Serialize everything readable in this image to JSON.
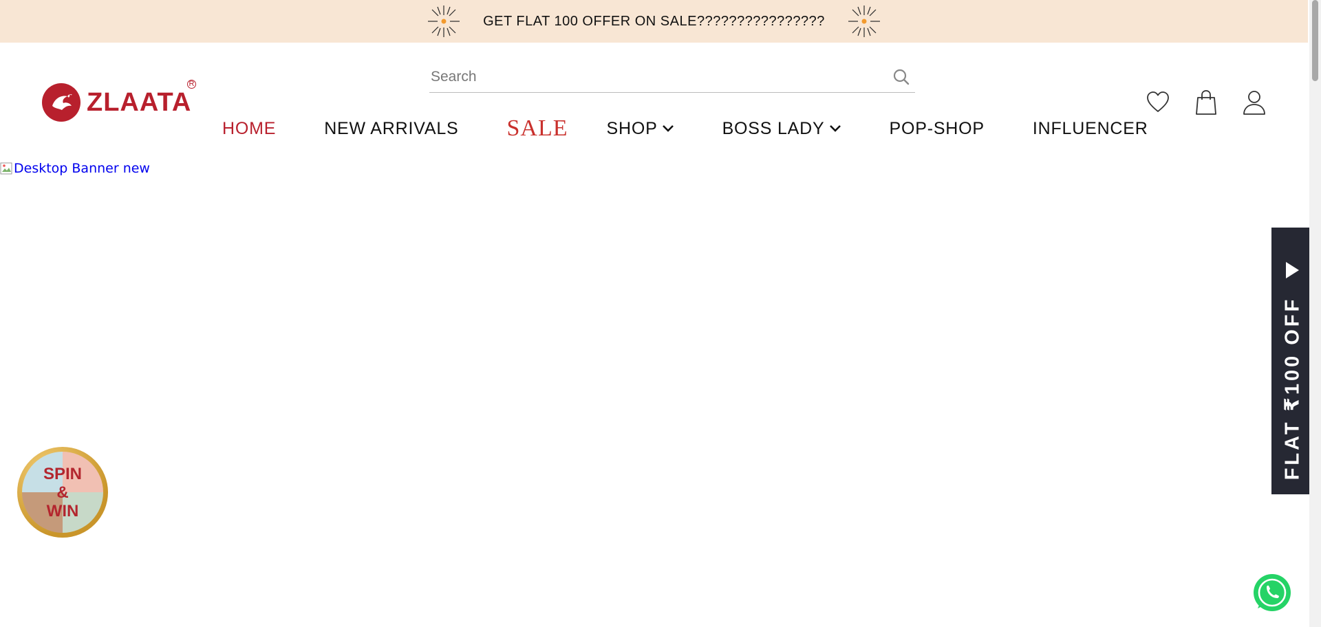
{
  "announcement": {
    "text": "GET FLAT 100 OFFER ON SALE????????????????",
    "left_icon": "firework-icon",
    "right_icon": "firework-icon"
  },
  "brand": {
    "name": "ZLAATA",
    "registered": "R",
    "color": "#b8202d"
  },
  "search": {
    "placeholder": "Search",
    "value": ""
  },
  "header_icons": [
    "heart-icon",
    "bag-icon",
    "user-icon"
  ],
  "nav": {
    "items": [
      {
        "label": "HOME"
      },
      {
        "label": "NEW ARRIVALS"
      },
      {
        "label": "SALE"
      },
      {
        "label": "SHOP"
      },
      {
        "label": "BOSS LADY"
      },
      {
        "label": "POP-SHOP"
      },
      {
        "label": "INFLUENCER"
      }
    ]
  },
  "banner": {
    "alt_text": "Desktop Banner new"
  },
  "side_tab": {
    "text": "FLAT ₹100 OFF",
    "bg_color": "#262833"
  },
  "spin_widget": {
    "line1": "SPIN",
    "line2": "&",
    "line3": "WIN"
  },
  "colors": {
    "announcement_bg": "#f8e6d4",
    "accent": "#b8202d",
    "link": "#0000ee",
    "whatsapp": "#25d366"
  }
}
